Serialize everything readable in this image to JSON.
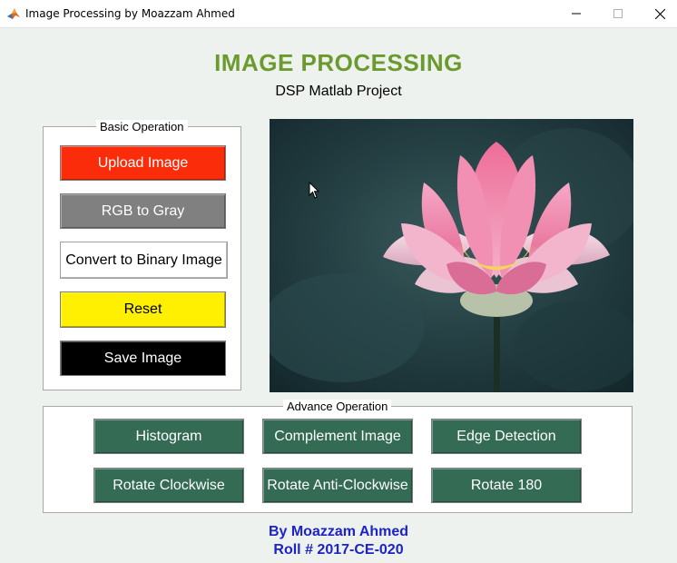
{
  "window": {
    "title": "Image Processing by Moazzam Ahmed",
    "icon": "matlab-icon",
    "controls": [
      "minimize-icon",
      "maximize-icon",
      "close-icon"
    ]
  },
  "header": {
    "title": "IMAGE PROCESSING",
    "subtitle": "DSP Matlab Project"
  },
  "basic_panel": {
    "title": "Basic Operation",
    "buttons": [
      {
        "label": "Upload Image",
        "color": "#fa2c0a"
      },
      {
        "label": "RGB to Gray",
        "color": "#808080"
      },
      {
        "label": "Convert to Binary Image",
        "color": "#ffffff"
      },
      {
        "label": "Reset",
        "color": "#ffef00"
      },
      {
        "label": "Save Image",
        "color": "#000000"
      }
    ]
  },
  "advance_panel": {
    "title": "Advance Operation",
    "buttons": [
      {
        "label": "Histogram"
      },
      {
        "label": "Complement Image"
      },
      {
        "label": "Edge Detection"
      },
      {
        "label": "Rotate Clockwise"
      },
      {
        "label": "Rotate Anti-Clockwise"
      },
      {
        "label": "Rotate 180"
      }
    ],
    "button_color": "#336b55"
  },
  "image": {
    "subject": "pink lotus flower on dark teal background"
  },
  "footer": {
    "author": "By Moazzam Ahmed",
    "roll": "Roll # 2017-CE-020"
  },
  "colors": {
    "accent_title": "#6b9a2e",
    "footer_text": "#1c23c8",
    "background": "#eef2ee"
  }
}
